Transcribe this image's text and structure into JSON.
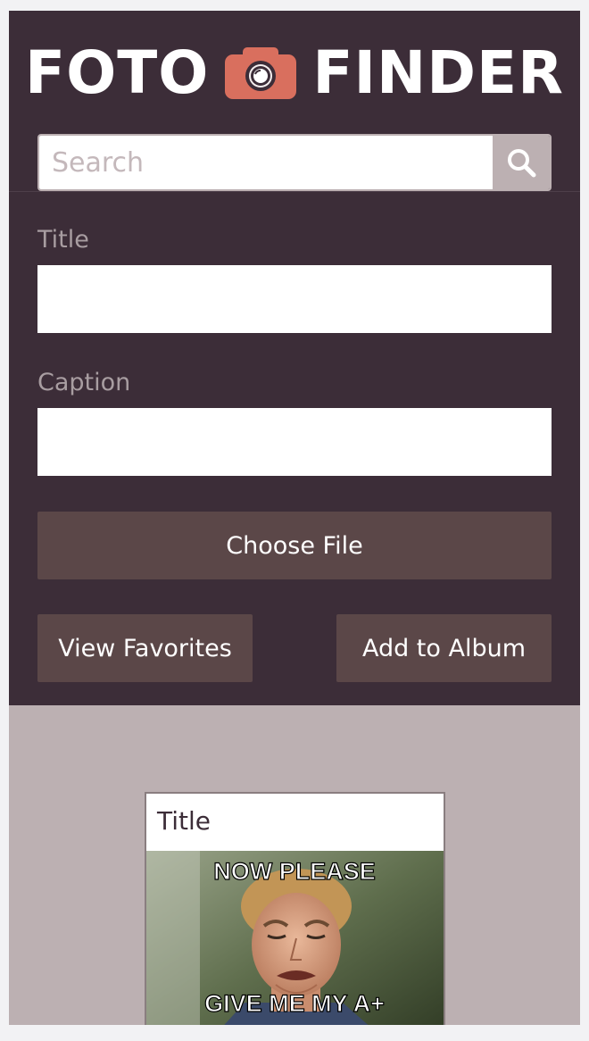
{
  "header": {
    "logo_left": "FOTO",
    "logo_right": "FINDER",
    "logo_icon": "camera-icon",
    "accent_color": "#d96f5e",
    "background_color": "#3c2d38"
  },
  "search": {
    "placeholder": "Search",
    "value": "",
    "icon": "search-icon"
  },
  "form": {
    "title_label": "Title",
    "title_value": "",
    "caption_label": "Caption",
    "caption_value": "",
    "choose_file_label": "Choose File",
    "view_favorites_label": "View Favorites",
    "add_to_album_label": "Add to Album",
    "button_color": "#5b4748"
  },
  "gallery": {
    "background_color": "#bcb0b2",
    "cards": [
      {
        "title": "Title",
        "image_caption_top": "NOW PLEASE",
        "image_caption_bottom": "GIVE ME MY A+"
      }
    ]
  }
}
